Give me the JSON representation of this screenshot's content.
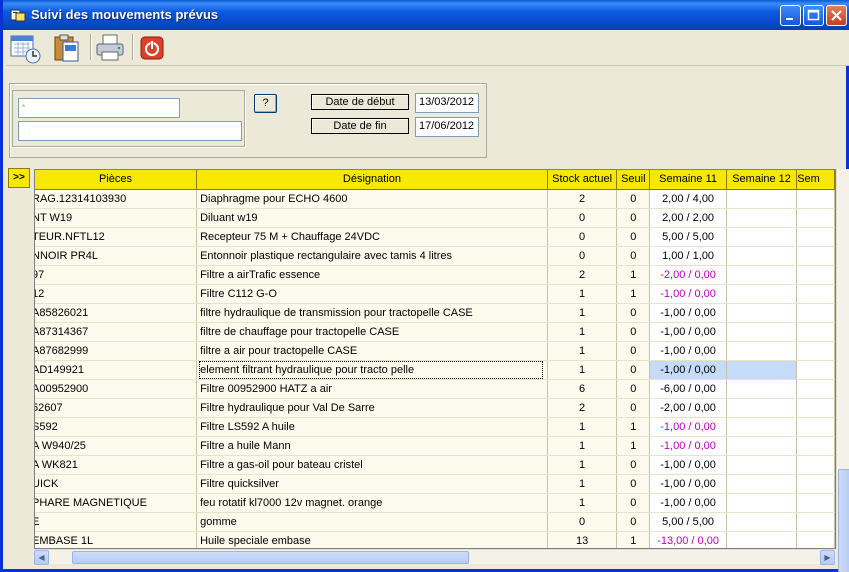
{
  "window": {
    "title": "Suivi des mouvements prévus"
  },
  "filters": {
    "field1_value": "",
    "field1_marker": "*",
    "field2_value": "",
    "help_button": "?",
    "start_label": "Date de début",
    "start_value": "13/03/2012",
    "end_label": "Date de fin",
    "end_value": "17/06/2012"
  },
  "panel_toggle": ">>",
  "grid": {
    "columns": [
      "Pièces",
      "Désignation",
      "Stock actuel",
      "Seuil",
      "Semaine 11",
      "Semaine 12",
      "Sem"
    ],
    "rows": [
      {
        "piece": "RAG.12314103930",
        "designation": "Diaphragme pour ECHO 4600",
        "stock": "2",
        "seuil": "0",
        "s11": "2,00 / 4,00",
        "neg": false
      },
      {
        "piece": "NT W19",
        "designation": "Diluant w19",
        "stock": "0",
        "seuil": "0",
        "s11": "2,00 / 2,00",
        "neg": false
      },
      {
        "piece": "TEUR.NFTL12",
        "designation": "Recepteur 75 M + Chauffage 24VDC",
        "stock": "0",
        "seuil": "0",
        "s11": "5,00 / 5,00",
        "neg": false
      },
      {
        "piece": "NNOIR PR4L",
        "designation": "Entonnoir plastique rectangulaire avec tamis 4 litres",
        "stock": "0",
        "seuil": "0",
        "s11": "1,00 / 1,00",
        "neg": false
      },
      {
        "piece": "97",
        "designation": "Filtre  a airTrafic essence",
        "stock": "2",
        "seuil": "1",
        "s11": "-2,00 / 0,00",
        "neg": true
      },
      {
        "piece": "12",
        "designation": "Filtre C112 G-O",
        "stock": "1",
        "seuil": "1",
        "s11": "-1,00 / 0,00",
        "neg": true
      },
      {
        "piece": "A85826021",
        "designation": "filtre hydraulique de transmission pour tractopelle CASE",
        "stock": "1",
        "seuil": "0",
        "s11": "-1,00 / 0,00",
        "neg": false
      },
      {
        "piece": "A87314367",
        "designation": "filtre de chauffage pour tractopelle CASE",
        "stock": "1",
        "seuil": "0",
        "s11": "-1,00 / 0,00",
        "neg": false
      },
      {
        "piece": "A87682999",
        "designation": "filtre a air pour tractopelle CASE",
        "stock": "1",
        "seuil": "0",
        "s11": "-1,00 / 0,00",
        "neg": false
      },
      {
        "piece": "AD149921",
        "designation": "element filtrant hydraulique pour tracto pelle",
        "stock": "1",
        "seuil": "0",
        "s11": "-1,00 / 0,00",
        "neg": false,
        "selected": true
      },
      {
        "piece": "A00952900",
        "designation": "Filtre 00952900 HATZ a air",
        "stock": "6",
        "seuil": "0",
        "s11": "-6,00 / 0,00",
        "neg": false
      },
      {
        "piece": "52607",
        "designation": "Filtre hydraulique pour Val De Sarre",
        "stock": "2",
        "seuil": "0",
        "s11": "-2,00 / 0,00",
        "neg": false
      },
      {
        "piece": "S592",
        "designation": "Filtre LS592 A huile",
        "stock": "1",
        "seuil": "1",
        "s11": "-1,00 / 0,00",
        "neg": true
      },
      {
        "piece": "A W940/25",
        "designation": "Filtre a huile Mann",
        "stock": "1",
        "seuil": "1",
        "s11": "-1,00 / 0,00",
        "neg": true
      },
      {
        "piece": "A WK821",
        "designation": "Filtre a gas-oil pour bateau cristel",
        "stock": "1",
        "seuil": "0",
        "s11": "-1,00 / 0,00",
        "neg": false
      },
      {
        "piece": "UICK",
        "designation": "Filtre quicksilver",
        "stock": "1",
        "seuil": "0",
        "s11": "-1,00 / 0,00",
        "neg": false
      },
      {
        "piece": "PHARE MAGNETIQUE",
        "designation": "feu rotatif kl7000 12v magnet. orange",
        "stock": "1",
        "seuil": "0",
        "s11": "-1,00 / 0,00",
        "neg": false
      },
      {
        "piece": "E",
        "designation": "gomme",
        "stock": "0",
        "seuil": "0",
        "s11": "5,00 / 5,00",
        "neg": false
      },
      {
        "piece": "EMBASE 1L",
        "designation": "Huile speciale embase",
        "stock": "13",
        "seuil": "1",
        "s11": "-13,00 / 0,00",
        "neg": true
      }
    ]
  }
}
